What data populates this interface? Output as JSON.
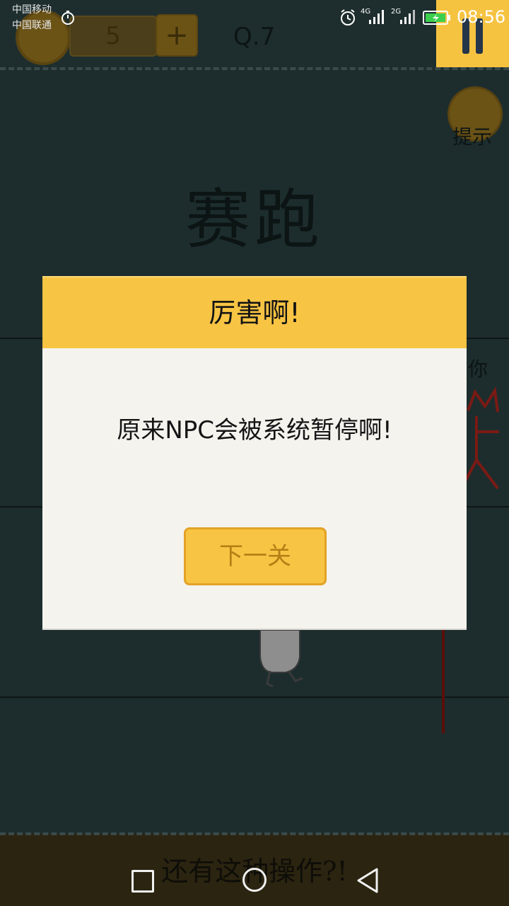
{
  "status_bar": {
    "carrier_1": "中国移动",
    "carrier_2": "中国联通",
    "net_1": "4G",
    "net_2": "2G",
    "time": "08:56"
  },
  "game": {
    "coin_count": "5",
    "plus_label": "+",
    "level": "Q.7",
    "hint_label": "提示",
    "title": "赛跑",
    "side_text": "你",
    "bottom_caption": "还有这种操作?!"
  },
  "dialog": {
    "title": "厉害啊!",
    "message": "原来NPC会被系统暂停啊!",
    "next_button": "下一关"
  },
  "colors": {
    "accent_yellow": "#f8c443",
    "dialog_bg": "#f4f3ee",
    "game_bg": "#1d2d2e"
  },
  "icons": [
    "stopwatch-icon",
    "alarm-icon",
    "signal-icon",
    "battery-icon",
    "pause-icon",
    "coin-icon",
    "lightbulb-icon",
    "square-icon",
    "circle-icon",
    "back-triangle-icon"
  ]
}
